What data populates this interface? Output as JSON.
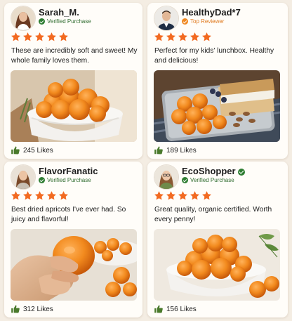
{
  "colors": {
    "star": "#f26a21",
    "verified": "#2e7d32",
    "top_reviewer": "#f08a24",
    "thumb": "#4a7a2c"
  },
  "reviews": [
    {
      "user": "Sarah_M.",
      "badge": "Verified Purchase",
      "badge_type": "verified",
      "name_check": false,
      "rating": 5,
      "text": "These are incredibly soft and sweet! My whole family loves them.",
      "likes": "245 Likes",
      "photo": "bowl-of-dried-apricots"
    },
    {
      "user": "HealthyDad*7",
      "badge": "Top Reviewer",
      "badge_type": "top",
      "name_check": false,
      "rating": 5,
      "text": "Perfect for my kids' lunchbox. Healthy and delicious!",
      "likes": "189 Likes",
      "photo": "lunchbox-with-apricots"
    },
    {
      "user": "FlavorFanatic",
      "badge": "Verified Purchase",
      "badge_type": "verified",
      "name_check": false,
      "rating": 5,
      "text": "Best dried apricots I've ever had. So juicy and flavorful!",
      "likes": "312 Likes",
      "photo": "hand-holding-apricot"
    },
    {
      "user": "EcoShopper",
      "badge": "Verified Purchase",
      "badge_type": "verified",
      "name_check": true,
      "rating": 5,
      "text": "Great quality, organic certified. Worth every penny!",
      "likes": "156 Likes",
      "photo": "bowl-of-apricots-with-leaves"
    }
  ]
}
